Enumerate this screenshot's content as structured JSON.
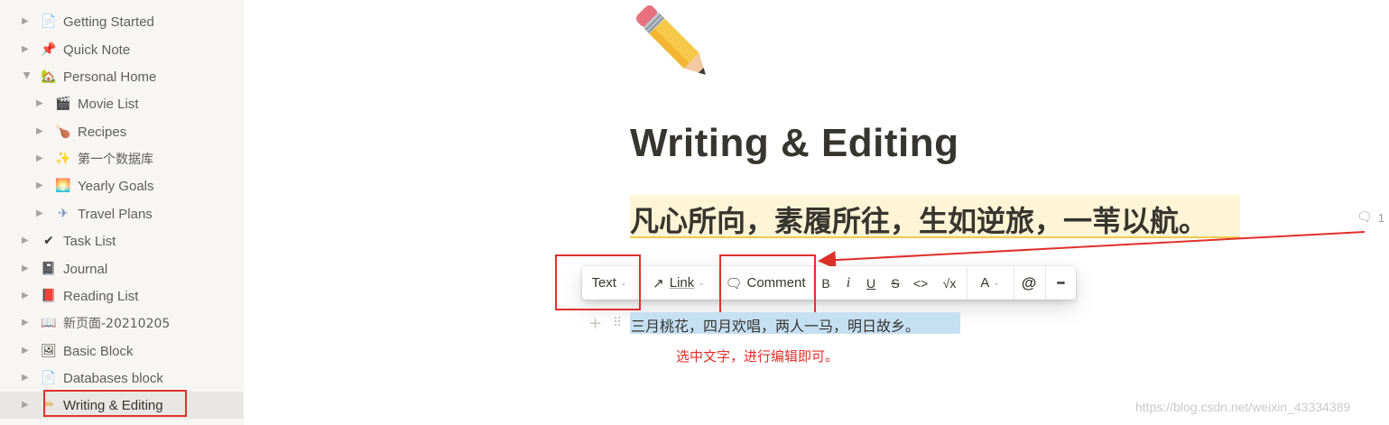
{
  "sidebar": {
    "items": [
      {
        "label": "Getting Started",
        "icon": "📄",
        "icon_name": "page-icon"
      },
      {
        "label": "Quick Note",
        "icon": "📌",
        "icon_name": "pin-icon"
      },
      {
        "label": "Personal Home",
        "icon": "🏡",
        "icon_name": "house-icon"
      },
      {
        "label": "Movie List",
        "icon": "🎬",
        "icon_name": "clapper-icon"
      },
      {
        "label": "Recipes",
        "icon": "🍗",
        "icon_name": "poultry-leg-icon"
      },
      {
        "label": "第一个数据库",
        "icon": "✨",
        "icon_name": "sparkles-icon"
      },
      {
        "label": "Yearly Goals",
        "icon": "🌅",
        "icon_name": "sunrise-icon"
      },
      {
        "label": "Travel Plans",
        "icon": "✈",
        "icon_name": "airplane-icon"
      },
      {
        "label": "Task List",
        "icon": "✔",
        "icon_name": "check-icon"
      },
      {
        "label": "Journal",
        "icon": "📓",
        "icon_name": "notebook-icon"
      },
      {
        "label": "Reading List",
        "icon": "📕",
        "icon_name": "book-icon"
      },
      {
        "label": "新页面-20210205",
        "icon": "📖",
        "icon_name": "open-book-icon"
      },
      {
        "label": "Basic Block",
        "icon": "🖼",
        "icon_name": "picture-icon"
      },
      {
        "label": "Databases block",
        "icon": "📄",
        "icon_name": "page-icon"
      },
      {
        "label": "Writing & Editing",
        "icon": "✏",
        "icon_name": "pencil-icon"
      }
    ]
  },
  "page": {
    "icon_name": "pencil-icon",
    "title": "Writing & Editing",
    "heading": "凡心所向，素履所往，生如逆旅，一苇以航。",
    "comment_count": "1",
    "paragraph": "三月桃花，四月欢唱，两人一马，明日故乡。",
    "note": "选中文字，进行编辑即可。"
  },
  "toolbar": {
    "text_label": "Text",
    "link_label": "Link",
    "comment_label": "Comment",
    "bold": "B",
    "italic": "i",
    "underline": "U",
    "strike": "S",
    "code": "<>",
    "equation": "√x",
    "color": "A",
    "mention": "@",
    "more": "•••"
  },
  "watermark": "https://blog.csdn.net/weixin_43334389",
  "colors": {
    "annotation_red": "#e0302b",
    "heading_highlight": "#fdf5d6",
    "selection_blue": "#c5e0f2",
    "sidebar_bg": "#f7f6f3"
  }
}
